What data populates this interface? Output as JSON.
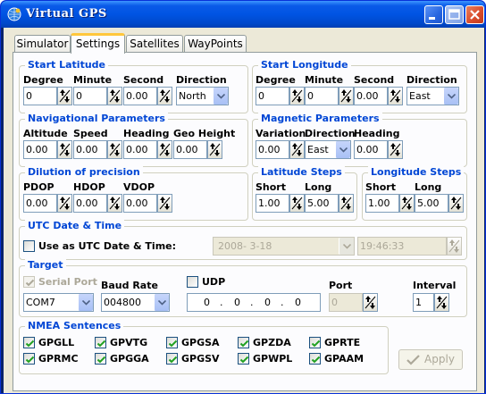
{
  "window": {
    "title": "Virtual GPS"
  },
  "tabs": [
    {
      "label": "Simulator",
      "active": false
    },
    {
      "label": "Settings",
      "active": true
    },
    {
      "label": "Satellites",
      "active": false
    },
    {
      "label": "WayPoints",
      "active": false
    }
  ],
  "start_latitude": {
    "title": "Start Latitude",
    "degree_label": "Degree",
    "minute_label": "Minute",
    "second_label": "Second",
    "direction_label": "Direction",
    "degree": "0",
    "minute": "0",
    "second": "0.00",
    "direction": "North"
  },
  "start_longitude": {
    "title": "Start Longitude",
    "degree_label": "Degree",
    "minute_label": "Minute",
    "second_label": "Second",
    "direction_label": "Direction",
    "degree": "0",
    "minute": "0",
    "second": "0.00",
    "direction": "East"
  },
  "navigational": {
    "title": "Navigational Parameters",
    "altitude_label": "Altitude",
    "speed_label": "Speed",
    "heading_label": "Heading",
    "geo_height_label": "Geo Height",
    "altitude": "0.00",
    "speed": "0.00",
    "heading": "0.00",
    "geo_height": "0.00"
  },
  "magnetic": {
    "title": "Magnetic Parameters",
    "variation_label": "Variation",
    "direction_label": "Direction",
    "heading_label": "Heading",
    "variation": "0.00",
    "direction": "East",
    "heading": "0.00"
  },
  "dop": {
    "title": "Dilution of precision",
    "pdop_label": "PDOP",
    "hdop_label": "HDOP",
    "vdop_label": "VDOP",
    "pdop": "0.00",
    "hdop": "0.00",
    "vdop": "0.00"
  },
  "latitude_steps": {
    "title": "Latitude Steps",
    "short_label": "Short",
    "long_label": "Long",
    "short": "1.00",
    "long": "5.00"
  },
  "longitude_steps": {
    "title": "Longitude Steps",
    "short_label": "Short",
    "long_label": "Long",
    "short": "1.00",
    "long": "5.00"
  },
  "utc": {
    "title": "UTC Date & Time",
    "checkbox_label": "Use as UTC Date & Time:",
    "checked": false,
    "date": "2008- 3-18",
    "time": "19:46:33"
  },
  "target": {
    "title": "Target",
    "serial_port_label": "Serial Port",
    "serial_port_checked": true,
    "serial_port": "COM7",
    "baud_rate_label": "Baud Rate",
    "baud_rate": "004800",
    "udp_label": "UDP",
    "udp_checked": false,
    "ip_octets": [
      "0",
      "0",
      "0",
      "0"
    ],
    "port_label": "Port",
    "port": "0",
    "interval_label": "Interval",
    "interval": "1"
  },
  "nmea": {
    "title": "NMEA Sentences",
    "sentences": [
      {
        "label": "GPGLL",
        "checked": true
      },
      {
        "label": "GPVTG",
        "checked": true
      },
      {
        "label": "GPGSA",
        "checked": true
      },
      {
        "label": "GPZDA",
        "checked": true
      },
      {
        "label": "GPRTE",
        "checked": true
      },
      {
        "label": "GPRMC",
        "checked": true
      },
      {
        "label": "GPGGA",
        "checked": true
      },
      {
        "label": "GPGSV",
        "checked": true
      },
      {
        "label": "GPWPL",
        "checked": true
      },
      {
        "label": "GPAAM",
        "checked": true
      }
    ]
  },
  "apply_button": {
    "label": "Apply",
    "enabled": false
  },
  "colors": {
    "group_title": "#0046d5",
    "titlebar": "#0054e3",
    "check_mark": "#21a121",
    "tab_highlight": "#ffc73c"
  },
  "icons": {
    "app": "gps-globe-icon",
    "spinner": "spinner-arrows-icon",
    "dropdown": "chevron-down-icon",
    "check": "checkmark-icon",
    "apply": "checkmark-outline-icon"
  }
}
